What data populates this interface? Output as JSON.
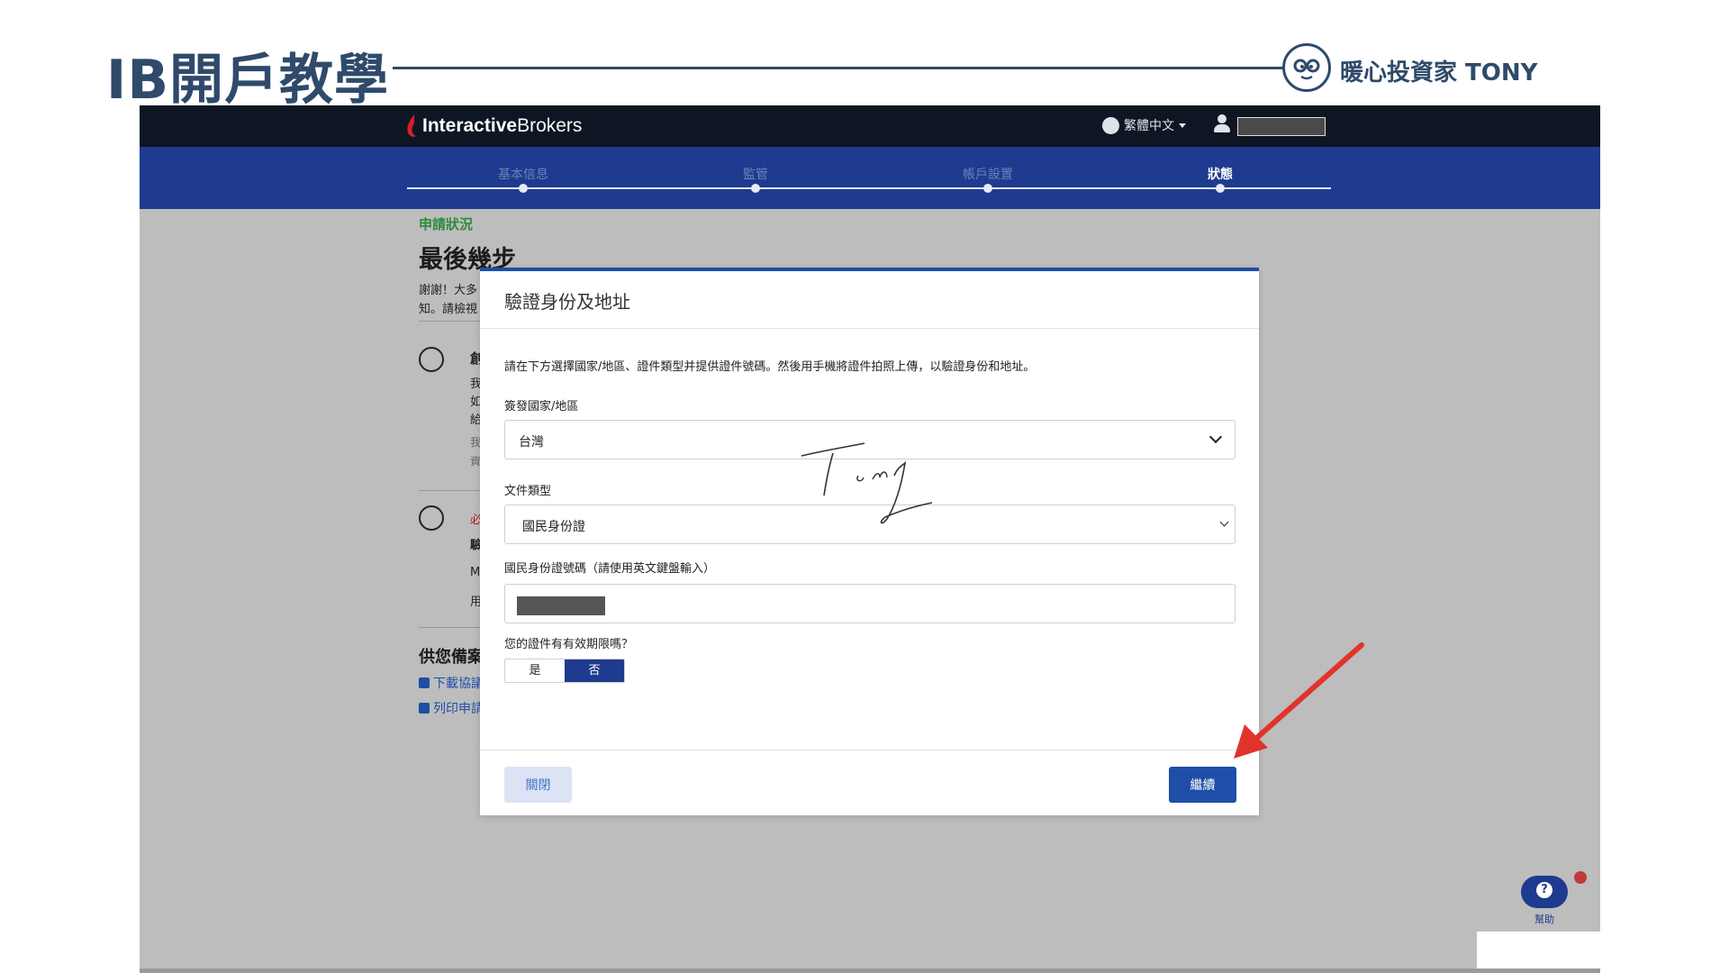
{
  "slide": {
    "title": "IB開戶教學",
    "brand": "暖心投資家 TONY"
  },
  "topbar": {
    "logo_bold": "Interactive",
    "logo_regular": "Brokers",
    "language": "繁體中文"
  },
  "steps": [
    {
      "label": "基本信息",
      "active": false
    },
    {
      "label": "監管",
      "active": false
    },
    {
      "label": "帳戶設置",
      "active": false
    },
    {
      "label": "狀態",
      "active": true
    }
  ],
  "background": {
    "kicker": "申請狀況",
    "heading": "最後幾步",
    "para_line1": "謝謝！大多",
    "para_line2": "知。請檢視",
    "item1_chars": [
      "創",
      "我",
      "如",
      "給",
      "我",
      "資"
    ],
    "item2_chars": [
      "必",
      "驗",
      "M",
      "用"
    ],
    "section": "供您備案",
    "link_download": "下載協議",
    "link_print": "列印申請"
  },
  "modal": {
    "title": "驗證身份及地址",
    "description": "請在下方選擇國家/地區、證件類型并提供證件號碼。然後用手機將證件拍照上傳，以驗證身份和地址。",
    "country_label": "簽發國家/地區",
    "country_value": "台灣",
    "doctype_label": "文件類型",
    "doctype_value": "國民身份證",
    "idnum_label": "國民身份證號碼（請使用英文鍵盤輸入）",
    "expiry_label": "您的證件有有效期限嗎？",
    "yes_label": "是",
    "no_label": "否",
    "close_label": "關閉",
    "continue_label": "繼續"
  },
  "help": {
    "label": "幫助"
  },
  "colors": {
    "navy": "#0e1624",
    "step_blue": "#1e3b8f",
    "primary_button": "#1e4ea8",
    "arrow_red": "#e0342a",
    "slide_title": "#2f4a6a"
  }
}
